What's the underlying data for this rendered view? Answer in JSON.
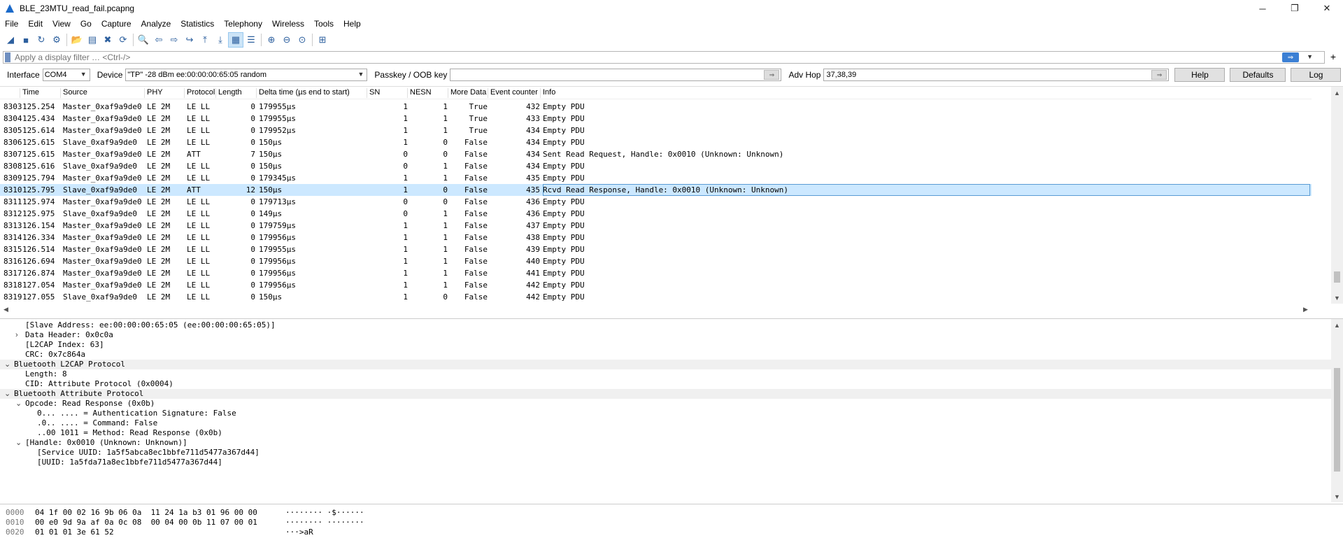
{
  "window": {
    "title": "BLE_23MTU_read_fail.pcapng",
    "minimize": "─",
    "restore": "❐",
    "close": "✕"
  },
  "menu": [
    "File",
    "Edit",
    "View",
    "Go",
    "Capture",
    "Analyze",
    "Statistics",
    "Telephony",
    "Wireless",
    "Tools",
    "Help"
  ],
  "toolbar_icons": [
    "shark-fin-start-icon",
    "stop-icon",
    "restart-icon",
    "options-icon",
    "open-icon",
    "save-icon",
    "close-file-icon",
    "reload-icon",
    "find-icon",
    "back-icon",
    "forward-icon",
    "goto-icon",
    "first-icon",
    "last-icon",
    "autoscroll-icon",
    "colorize-icon",
    "zoom-in-icon",
    "zoom-out-icon",
    "zoom-normal-icon",
    "resize-columns-icon"
  ],
  "filter": {
    "placeholder": "Apply a display filter … <Ctrl-/>",
    "apply_arrow": "⇒",
    "plus": "+"
  },
  "interface_bar": {
    "interface_label": "Interface",
    "interface_value": "COM4",
    "device_label": "Device",
    "device_value": "\"TP\"  -28 dBm  ee:00:00:00:65:05  random",
    "passkey_label": "Passkey / OOB key",
    "passkey_value": "",
    "advhop_label": "Adv Hop",
    "advhop_value": "37,38,39",
    "help_button": "Help",
    "defaults_button": "Defaults",
    "log_button": "Log"
  },
  "packet_list": {
    "columns": [
      "Time",
      "Source",
      "PHY",
      "Protocol",
      "Length",
      "Delta time (µs end to start)",
      "SN",
      "NESN",
      "More Data",
      "Event counter",
      "Info"
    ],
    "selected_index": 7,
    "rows": [
      [
        "8303",
        "125.254",
        "Master_0xaf9a9de0",
        "LE 2M",
        "LE LL",
        "0",
        "179955µs",
        "1",
        "1",
        "True",
        "432",
        "Empty PDU"
      ],
      [
        "8304",
        "125.434",
        "Master_0xaf9a9de0",
        "LE 2M",
        "LE LL",
        "0",
        "179955µs",
        "1",
        "1",
        "True",
        "433",
        "Empty PDU"
      ],
      [
        "8305",
        "125.614",
        "Master_0xaf9a9de0",
        "LE 2M",
        "LE LL",
        "0",
        "179952µs",
        "1",
        "1",
        "True",
        "434",
        "Empty PDU"
      ],
      [
        "8306",
        "125.615",
        "Slave_0xaf9a9de0",
        "LE 2M",
        "LE LL",
        "0",
        "150µs",
        "1",
        "0",
        "False",
        "434",
        "Empty PDU"
      ],
      [
        "8307",
        "125.615",
        "Master_0xaf9a9de0",
        "LE 2M",
        "ATT",
        "7",
        "150µs",
        "0",
        "0",
        "False",
        "434",
        "Sent Read Request, Handle: 0x0010 (Unknown: Unknown)"
      ],
      [
        "8308",
        "125.616",
        "Slave_0xaf9a9de0",
        "LE 2M",
        "LE LL",
        "0",
        "150µs",
        "0",
        "1",
        "False",
        "434",
        "Empty PDU"
      ],
      [
        "8309",
        "125.794",
        "Master_0xaf9a9de0",
        "LE 2M",
        "LE LL",
        "0",
        "179345µs",
        "1",
        "1",
        "False",
        "435",
        "Empty PDU"
      ],
      [
        "8310",
        "125.795",
        "Slave_0xaf9a9de0",
        "LE 2M",
        "ATT",
        "12",
        "150µs",
        "1",
        "0",
        "False",
        "435",
        "Rcvd Read Response, Handle: 0x0010 (Unknown: Unknown)"
      ],
      [
        "8311",
        "125.974",
        "Master_0xaf9a9de0",
        "LE 2M",
        "LE LL",
        "0",
        "179713µs",
        "0",
        "0",
        "False",
        "436",
        "Empty PDU"
      ],
      [
        "8312",
        "125.975",
        "Slave_0xaf9a9de0",
        "LE 2M",
        "LE LL",
        "0",
        "149µs",
        "0",
        "1",
        "False",
        "436",
        "Empty PDU"
      ],
      [
        "8313",
        "126.154",
        "Master_0xaf9a9de0",
        "LE 2M",
        "LE LL",
        "0",
        "179759µs",
        "1",
        "1",
        "False",
        "437",
        "Empty PDU"
      ],
      [
        "8314",
        "126.334",
        "Master_0xaf9a9de0",
        "LE 2M",
        "LE LL",
        "0",
        "179956µs",
        "1",
        "1",
        "False",
        "438",
        "Empty PDU"
      ],
      [
        "8315",
        "126.514",
        "Master_0xaf9a9de0",
        "LE 2M",
        "LE LL",
        "0",
        "179955µs",
        "1",
        "1",
        "False",
        "439",
        "Empty PDU"
      ],
      [
        "8316",
        "126.694",
        "Master_0xaf9a9de0",
        "LE 2M",
        "LE LL",
        "0",
        "179956µs",
        "1",
        "1",
        "False",
        "440",
        "Empty PDU"
      ],
      [
        "8317",
        "126.874",
        "Master_0xaf9a9de0",
        "LE 2M",
        "LE LL",
        "0",
        "179956µs",
        "1",
        "1",
        "False",
        "441",
        "Empty PDU"
      ],
      [
        "8318",
        "127.054",
        "Master_0xaf9a9de0",
        "LE 2M",
        "LE LL",
        "0",
        "179956µs",
        "1",
        "1",
        "False",
        "442",
        "Empty PDU"
      ],
      [
        "8319",
        "127.055",
        "Slave_0xaf9a9de0",
        "LE 2M",
        "LE LL",
        "0",
        "150µs",
        "1",
        "0",
        "False",
        "442",
        "Empty PDU"
      ]
    ]
  },
  "details": [
    {
      "indent": 2,
      "twisty": "",
      "text": "[Slave Address: ee:00:00:00:65:05 (ee:00:00:00:65:05)]",
      "section": false
    },
    {
      "indent": 2,
      "twisty": "›",
      "text": "Data Header: 0x0c0a",
      "section": false
    },
    {
      "indent": 2,
      "twisty": "",
      "text": "[L2CAP Index: 63]",
      "section": false
    },
    {
      "indent": 2,
      "twisty": "",
      "text": "CRC: 0x7c864a",
      "section": false
    },
    {
      "indent": 1,
      "twisty": "⌄",
      "text": "Bluetooth L2CAP Protocol",
      "section": true
    },
    {
      "indent": 2,
      "twisty": "",
      "text": "Length: 8",
      "section": false
    },
    {
      "indent": 2,
      "twisty": "",
      "text": "CID: Attribute Protocol (0x0004)",
      "section": false
    },
    {
      "indent": 1,
      "twisty": "⌄",
      "text": "Bluetooth Attribute Protocol",
      "section": true
    },
    {
      "indent": 2,
      "twisty": "⌄",
      "text": "Opcode: Read Response (0x0b)",
      "section": false
    },
    {
      "indent": 3,
      "twisty": "",
      "text": "0... .... = Authentication Signature: False",
      "section": false
    },
    {
      "indent": 3,
      "twisty": "",
      "text": ".0.. .... = Command: False",
      "section": false
    },
    {
      "indent": 3,
      "twisty": "",
      "text": "..00 1011 = Method: Read Response (0x0b)",
      "section": false
    },
    {
      "indent": 2,
      "twisty": "⌄",
      "text": "[Handle: 0x0010 (Unknown: Unknown)]",
      "section": false
    },
    {
      "indent": 3,
      "twisty": "",
      "text": "[Service UUID: 1a5f5abca8ec1bbfe711d5477a367d44]",
      "section": false
    },
    {
      "indent": 3,
      "twisty": "",
      "text": "[UUID: 1a5fda71a8ec1bbfe711d5477a367d44]",
      "section": false
    }
  ],
  "hex": [
    {
      "offset": "0000",
      "bytes": "04 1f 00 02 16 9b 06 0a  11 24 1a b3 01 96 00 00",
      "ascii": "········ ·$······"
    },
    {
      "offset": "0010",
      "bytes": "00 e0 9d 9a af 0a 0c 08  00 04 00 0b 11 07 00 01",
      "ascii": "········ ········"
    },
    {
      "offset": "0020",
      "bytes": "01 01 01 3e 61 52",
      "ascii": "···>aR"
    }
  ]
}
